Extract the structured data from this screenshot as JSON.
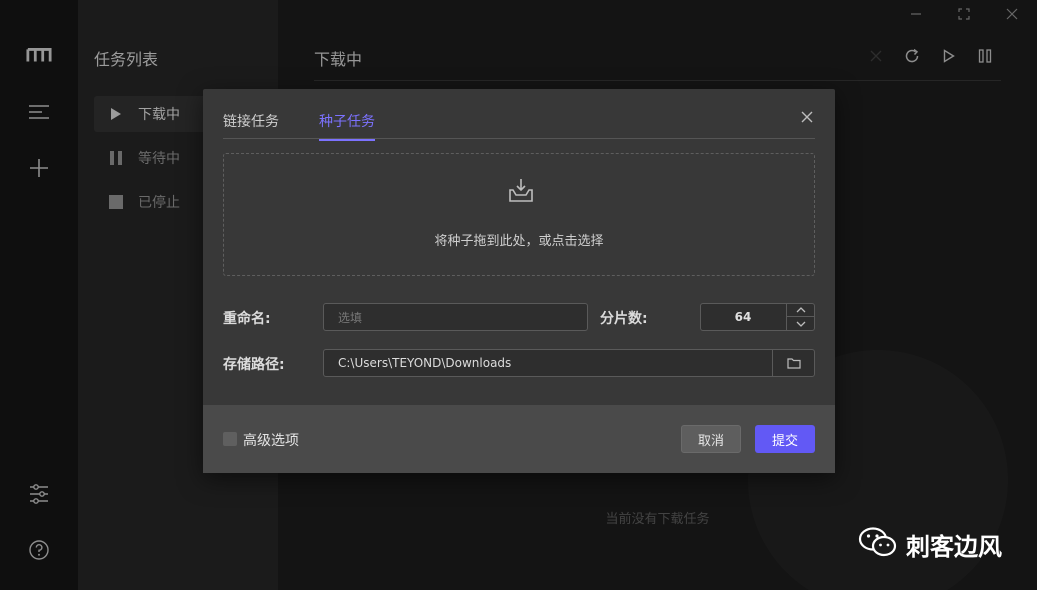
{
  "sidebar": {
    "list_title": "任务列表",
    "items": [
      {
        "label": "下载中",
        "icon": "play-icon"
      },
      {
        "label": "等待中",
        "icon": "pause-icon"
      },
      {
        "label": "已停止",
        "icon": "stop-icon"
      }
    ]
  },
  "main": {
    "title": "下载中",
    "empty_text": "当前没有下载任务"
  },
  "dialog": {
    "tabs": [
      {
        "label": "链接任务",
        "active": false
      },
      {
        "label": "种子任务",
        "active": true
      }
    ],
    "dropzone_text": "将种子拖到此处，或点击选择",
    "rename_label": "重命名:",
    "rename_placeholder": "选填",
    "split_label": "分片数:",
    "split_value": "64",
    "path_label": "存储路径:",
    "path_value": "C:\\Users\\TEYOND\\Downloads",
    "advanced_label": "高级选项",
    "cancel_label": "取消",
    "submit_label": "提交"
  },
  "colors": {
    "accent": "#6259f5",
    "tab_active": "#7c72ff"
  },
  "watermark": {
    "text": "刺客边风"
  }
}
